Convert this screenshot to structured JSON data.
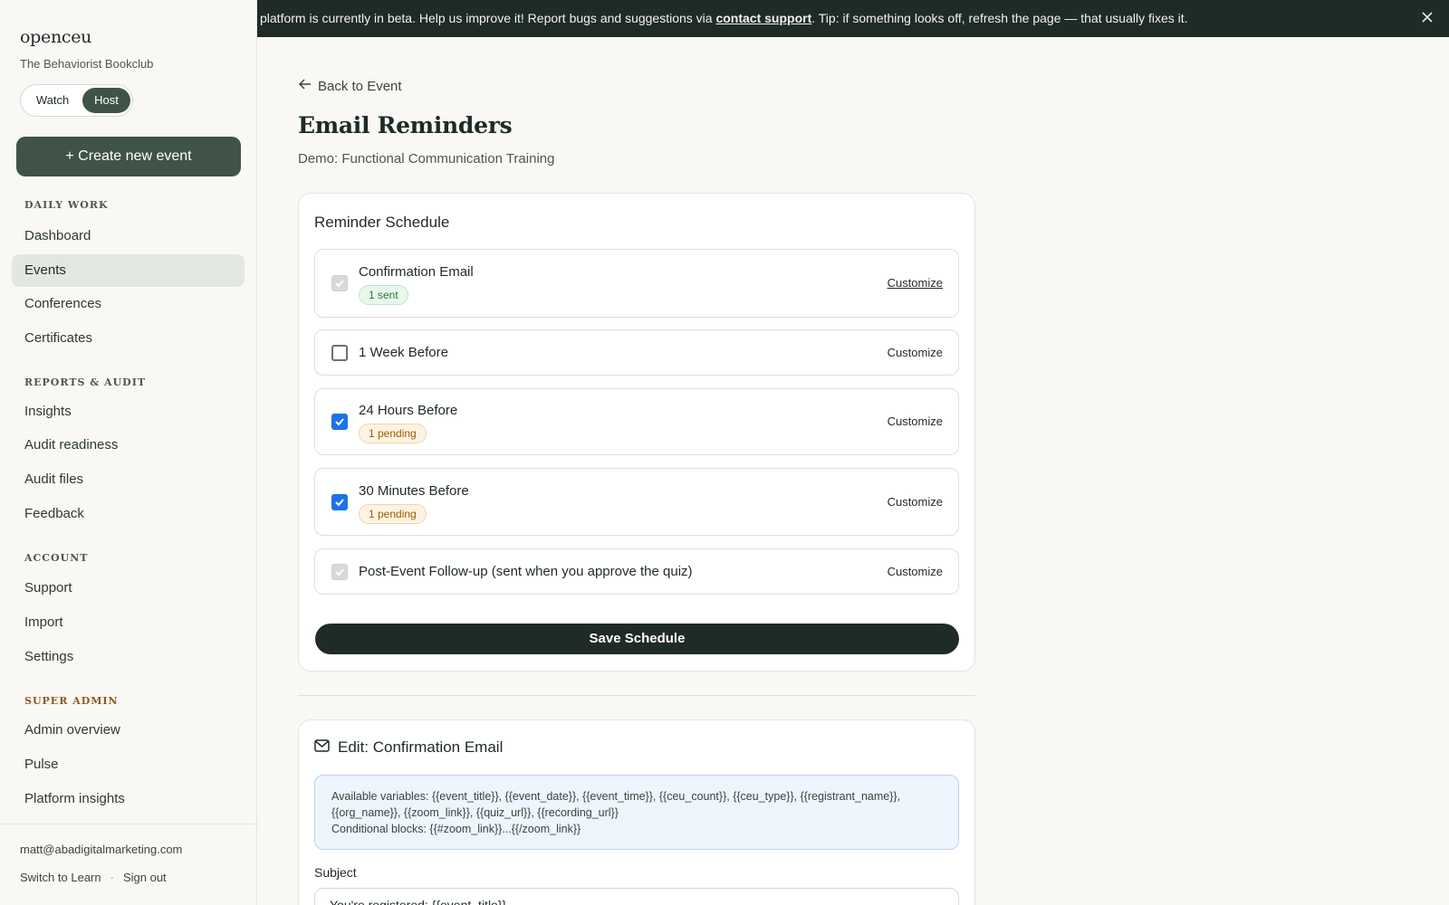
{
  "sidebar": {
    "brand": "openceu",
    "org_name": "The Behaviorist Bookclub",
    "mode_toggle": {
      "watch": "Watch",
      "host": "Host",
      "selected": "Host"
    },
    "create_button": "+ Create new event",
    "sections": [
      {
        "heading": "Daily work",
        "items": [
          "Dashboard",
          "Events",
          "Conferences",
          "Certificates"
        ]
      },
      {
        "heading": "Reports & audit",
        "items": [
          "Insights",
          "Audit readiness",
          "Audit files",
          "Feedback"
        ]
      },
      {
        "heading": "Account",
        "items": [
          "Support",
          "Import",
          "Settings"
        ]
      },
      {
        "heading": "Super admin",
        "items": [
          "Admin overview",
          "Pulse",
          "Platform insights"
        ]
      }
    ],
    "active_item": "Events",
    "footer": {
      "email": "matt@abadigitalmarketing.com",
      "switch_link": "Switch to Learn",
      "separator": "·",
      "sign_out": "Sign out"
    }
  },
  "banner": {
    "text_before": "platform is currently in beta. Help us improve it! Report bugs and suggestions via ",
    "link": "contact support",
    "text_after": ". Tip: if something looks off, refresh the page — that usually fixes it.",
    "close_icon": "close-icon"
  },
  "main": {
    "back_link": "Back to Event",
    "title": "Email Reminders",
    "subtitle": "Demo: Functional Communication Training",
    "schedule": {
      "title": "Reminder Schedule",
      "items": [
        {
          "label": "Confirmation Email",
          "state": "disabled-checked",
          "badge": "1 sent",
          "badge_type": "sent",
          "customize": "Customize"
        },
        {
          "label": "1 Week Before",
          "state": "unchecked",
          "badge": "",
          "badge_type": "",
          "customize": "Customize"
        },
        {
          "label": "24 Hours Before",
          "state": "checked",
          "badge": "1 pending",
          "badge_type": "pending",
          "customize": "Customize"
        },
        {
          "label": "30 Minutes Before",
          "state": "checked",
          "badge": "1 pending",
          "badge_type": "pending",
          "customize": "Customize"
        },
        {
          "label": "Post-Event Follow-up (sent when you approve the quiz)",
          "state": "disabled-checked",
          "badge": "",
          "badge_type": "",
          "customize": "Customize"
        }
      ],
      "save_button": "Save Schedule"
    },
    "editor": {
      "title": "Edit: Confirmation Email",
      "vars_line1": "Available variables: {{event_title}}, {{event_date}}, {{event_time}}, {{ceu_count}}, {{ceu_type}}, {{registrant_name}},",
      "vars_line2": "{{org_name}}, {{zoom_link}}, {{quiz_url}}, {{recording_url}}",
      "vars_line3": "Conditional blocks: {{#zoom_link}}...{{/zoom_link}}",
      "subject_label": "Subject",
      "subject_value": "You're registered: {{event_title}}"
    }
  },
  "colors": {
    "primary": "#3f5446",
    "dark": "#1f2b28",
    "checkbox": "#1a73e8",
    "sent": "#237a3b",
    "pending": "#9a5d00"
  }
}
